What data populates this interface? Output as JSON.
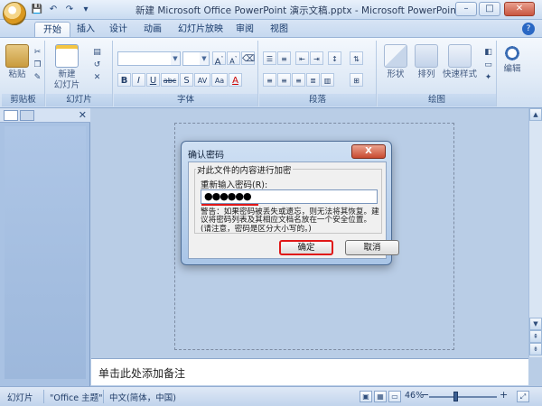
{
  "window": {
    "title": "新建 Microsoft Office PowerPoint 演示文稿.pptx - Microsoft PowerPoint",
    "controls": [
      "–",
      "□",
      "✕"
    ]
  },
  "quick_access": [
    "💾",
    "↶",
    "↷",
    "▾"
  ],
  "tabs": [
    {
      "label": "开始",
      "active": true
    },
    {
      "label": "插入"
    },
    {
      "label": "设计"
    },
    {
      "label": "动画"
    },
    {
      "label": "幻灯片放映"
    },
    {
      "label": "审阅"
    },
    {
      "label": "视图"
    }
  ],
  "help_glyph": "?",
  "ribbon": {
    "clipboard": {
      "label": "剪贴板",
      "paste": "粘贴"
    },
    "slides": {
      "label": "幻灯片",
      "new_slide": "新建",
      "new_slide2": "幻灯片 ▾"
    },
    "font": {
      "label": "字体",
      "buttons": [
        "B",
        "I",
        "U",
        "abc",
        "S",
        "AV",
        "Aa",
        "A"
      ]
    },
    "paragraph": {
      "label": "段落"
    },
    "drawing": {
      "label": "绘图",
      "shapes": "形状",
      "arrange": "排列",
      "quick_styles": "快速样式"
    },
    "editing": {
      "label": "编辑"
    }
  },
  "notes": {
    "placeholder": "单击此处添加备注"
  },
  "status": {
    "slide": "幻灯片",
    "theme": "\"Office 主题\"",
    "language": "中文(简体，中国)",
    "zoom": "46%",
    "zoom_level": 0.46
  },
  "dialog": {
    "title": "确认密码",
    "close_glyph": "X",
    "group_label": "对此文件的内容进行加密",
    "field_label": "重新输入密码(R):",
    "field_value": "●●●●●●",
    "warning": "警告：如果密码被丢失或遗忘，则无法将其恢复。建议将密码列表及其相应文档名放在一个安全位置。(请注意，密码是区分大小写的。)",
    "ok": "确定",
    "cancel": "取消"
  }
}
